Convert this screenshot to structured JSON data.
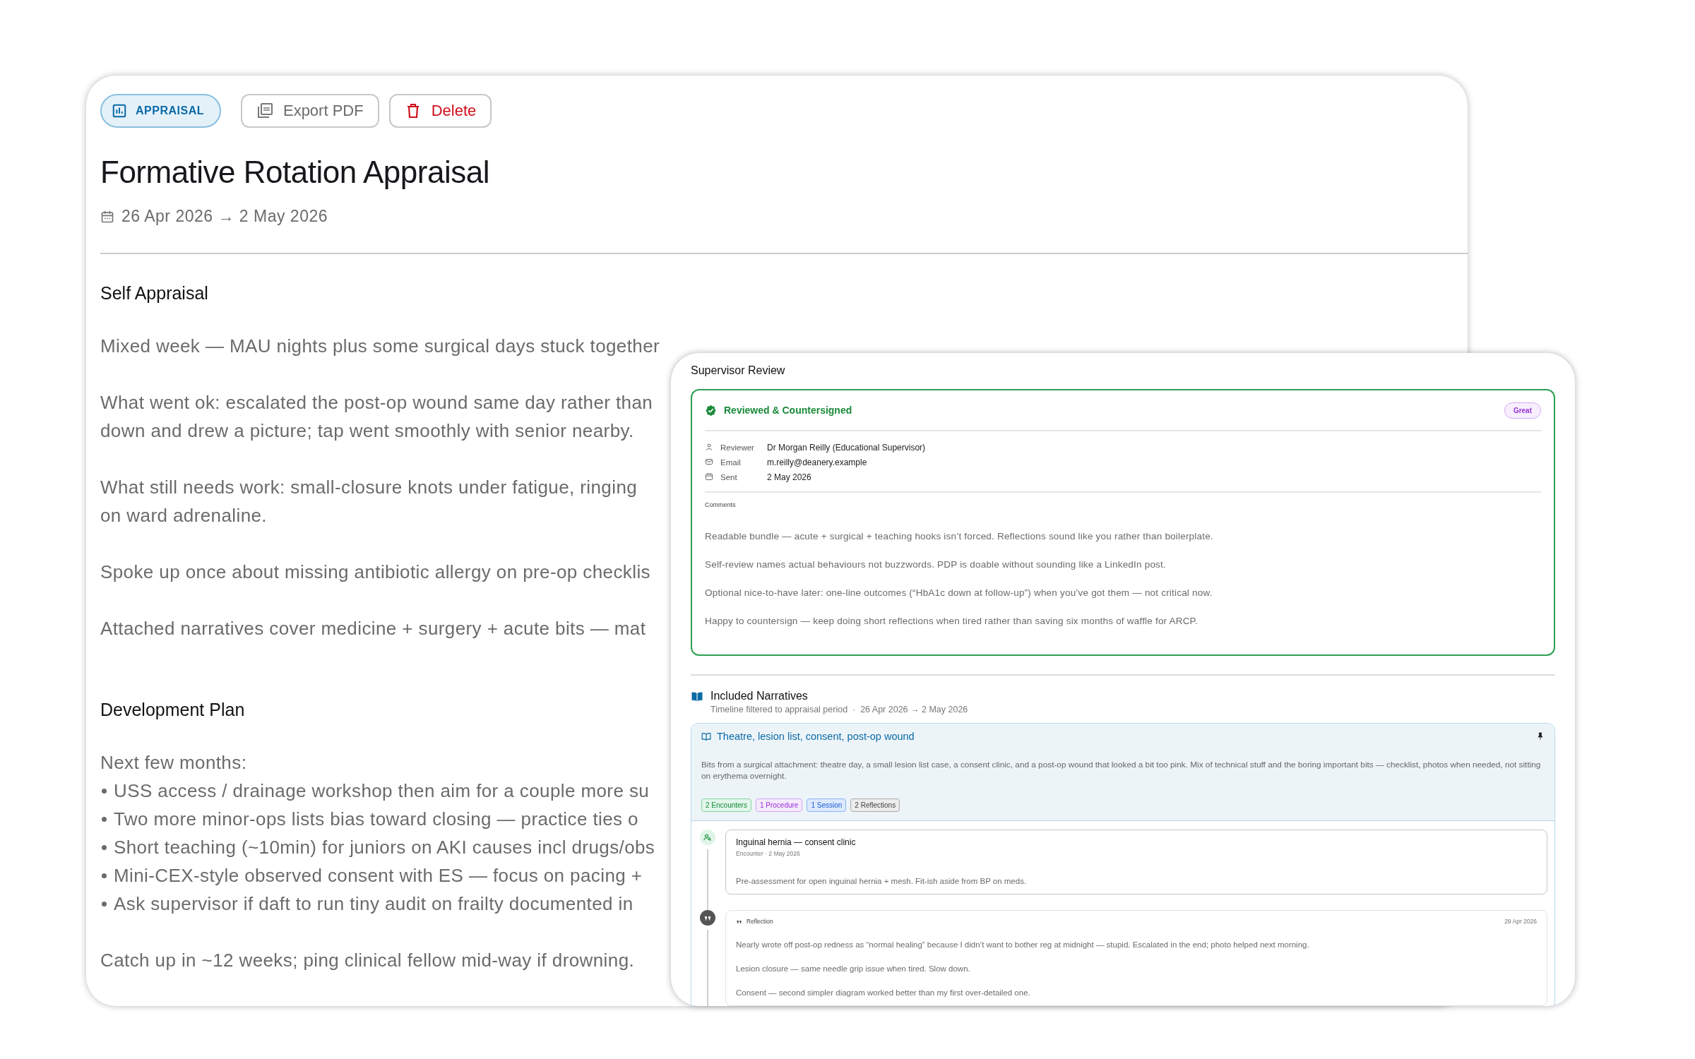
{
  "toolbar": {
    "badge": {
      "label": "APPRAISAL"
    },
    "buttons": [
      {
        "label": "Export PDF",
        "kind": "export"
      },
      {
        "label": "Delete",
        "kind": "delete"
      }
    ]
  },
  "title": "Formative Rotation Appraisal",
  "period": "26 Apr 2026 → 2 May 2026",
  "self_appraisal": {
    "heading": "Self Appraisal",
    "paragraphs": [
      {
        "lines": [
          "Mixed week — MAU nights plus some surgical days stuck together"
        ]
      },
      {
        "lines": [
          "What went ok: escalated the post-op wound same day rather than",
          "down and drew a picture; tap went smoothly with senior nearby."
        ]
      },
      {
        "lines": [
          "What still needs work: small-closure knots under fatigue, ringing",
          "on ward adrenaline."
        ]
      },
      {
        "lines": [
          "Spoke up once about missing antibiotic allergy on pre-op checklis"
        ]
      },
      {
        "lines": [
          "Attached narratives cover medicine + surgery + acute bits — mat"
        ]
      }
    ]
  },
  "development_plan": {
    "heading": "Development Plan",
    "intro": "Next few months:",
    "bullets": [
      "USS access / drainage workshop then aim for a couple more su",
      "Two more minor-ops lists bias toward closing — practice ties o",
      "Short teaching (~10min) for juniors on AKI causes incl drugs/obs",
      "Mini-CEX-style observed consent with ES — focus on pacing +",
      "Ask supervisor if daft to run tiny audit on frailty documented in"
    ],
    "closing": "Catch up in ~12 weeks; ping clinical fellow mid-way if drowning."
  },
  "supervisor_review": {
    "title": "Supervisor Review",
    "status": {
      "label": "Reviewed & Countersigned",
      "verified": true
    },
    "rating": "Great",
    "details": [
      {
        "kind": "reviewer",
        "label": "Reviewer",
        "value": "Dr Morgan Reilly (Educational Supervisor)"
      },
      {
        "kind": "email",
        "label": "Email",
        "value": "m.reilly@deanery.example"
      },
      {
        "kind": "sent",
        "label": "Sent",
        "value": "2 May 2026"
      }
    ],
    "comments_label": "Comments",
    "comments": [
      "Readable bundle — acute + surgical + teaching hooks isn’t forced. Reflections sound like you rather than boilerplate.",
      "Self-review names actual behaviours not buzzwords. PDP is doable without sounding like a LinkedIn post.",
      "Optional nice-to-have later: one-line outcomes (“HbA1c down at follow-up”) when you’ve got them — not critical now.",
      "Happy to countersign — keep doing short reflections when tired rather than saving six months of waffle for ARCP."
    ]
  },
  "included_narratives": {
    "title": "Included Narratives",
    "subtitle": "Timeline filtered to appraisal period  ·  26 Apr 2026 → 2 May 2026",
    "narratives": [
      {
        "title": "Theatre, lesion list, consent, post-op wound",
        "pinned": true,
        "description": "Bits from a surgical attachment: theatre day, a small lesion list case, a consent clinic, and a post-op wound that looked a bit too pink. Mix of technical stuff and the boring important bits — checklist, photos when needed, not sitting on erythema overnight.",
        "tags": [
          {
            "label": "2 Encounters",
            "kind": "encounter"
          },
          {
            "label": "1 Procedure",
            "kind": "procedure"
          },
          {
            "label": "1 Session",
            "kind": "session"
          },
          {
            "label": "2 Reflections",
            "kind": "reflection"
          }
        ],
        "items": [
          {
            "kind": "encounter",
            "title": "Inguinal hernia — consent clinic",
            "meta": "Encounter · 2 May 2026",
            "paragraphs": [
              "Pre-assessment for open inguinal hernia + mesh. Fit-ish aside from BP on meds."
            ]
          },
          {
            "kind": "reflection",
            "title": "Reflection",
            "meta": "29 Apr 2026",
            "paragraphs": [
              "Nearly wrote off post-op redness as “normal healing” because I didn’t want to bother reg at midnight — stupid. Escalated in the end; photo helped next morning.",
              "Lesion closure — same needle grip issue when tired. Slow down.",
              "Consent — second simpler diagram worked better than my first over-detailed one."
            ]
          }
        ]
      }
    ]
  }
}
